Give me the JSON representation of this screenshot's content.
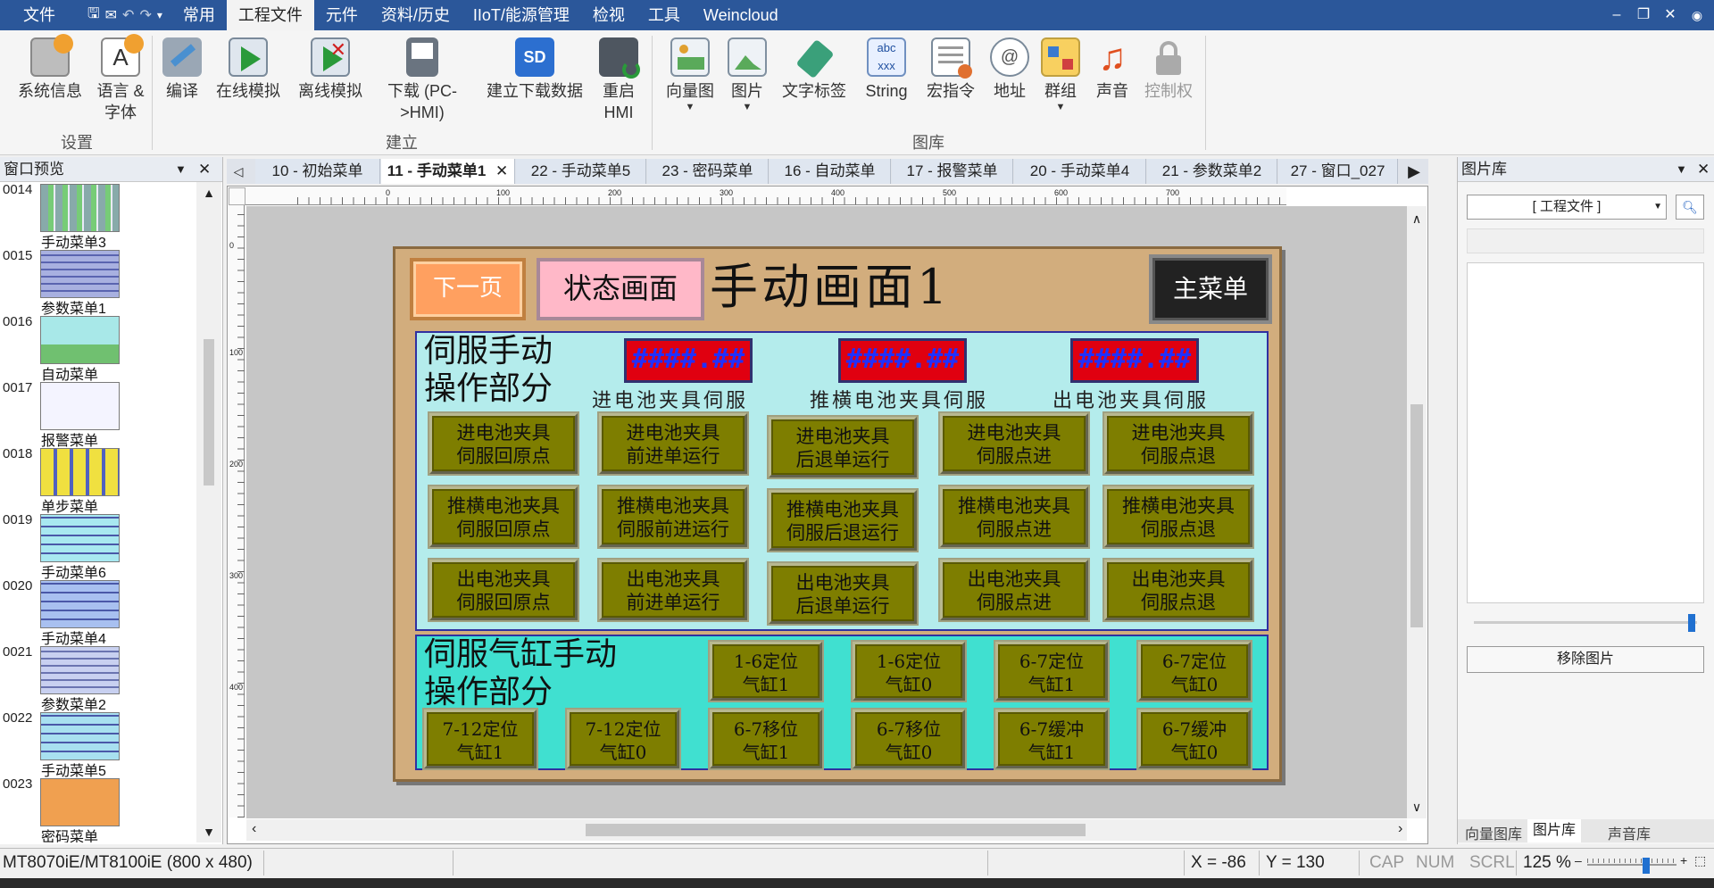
{
  "menubar": {
    "file": "文件",
    "tabs": [
      "常用",
      "工程文件",
      "元件",
      "资料/历史",
      "IIoT/能源管理",
      "检视",
      "工具",
      "Weincloud"
    ],
    "active_tab": "工程文件"
  },
  "ribbon": {
    "settings_group": "设置",
    "build_group": "建立",
    "library_group": "图库",
    "buttons": {
      "system_info": "系统信息",
      "language_font": "语言 & 字体",
      "compile": "编译",
      "online_sim": "在线模拟",
      "offline_sim": "离线模拟",
      "download": "下载 (PC->HMI)",
      "build_download_data": "建立下载数据",
      "restart_hmi": "重启 HMI",
      "vector_image": "向量图",
      "image": "图片",
      "text_tag": "文字标签",
      "string": "String",
      "macro": "宏指令",
      "address": "地址",
      "group": "群组",
      "sound": "声音",
      "control": "控制权"
    }
  },
  "left_panel": {
    "title": "窗口预览",
    "items": [
      {
        "num": "0014",
        "label": "手动菜单3"
      },
      {
        "num": "0015",
        "label": "参数菜单1"
      },
      {
        "num": "0016",
        "label": "自动菜单"
      },
      {
        "num": "0017",
        "label": "报警菜单"
      },
      {
        "num": "0018",
        "label": "单步菜单"
      },
      {
        "num": "0019",
        "label": "手动菜单6"
      },
      {
        "num": "0020",
        "label": "手动菜单4"
      },
      {
        "num": "0021",
        "label": "参数菜单2"
      },
      {
        "num": "0022",
        "label": "手动菜单5"
      },
      {
        "num": "0023",
        "label": "密码菜单"
      }
    ]
  },
  "doc_tabs": [
    "10 - 初始菜单",
    "11 - 手动菜单1",
    "22 - 手动菜单5",
    "23 - 密码菜单",
    "16 - 自动菜单",
    "17 - 报警菜单",
    "20 - 手动菜单4",
    "21 - 参数菜单2",
    "27 - 窗口_027"
  ],
  "ruler": {
    "h_ticks": [
      "0",
      "100",
      "200",
      "300",
      "400",
      "500",
      "600",
      "700"
    ],
    "v_ticks": [
      "0",
      "100",
      "200",
      "300",
      "400"
    ]
  },
  "hmi": {
    "next_page": "下一页",
    "status_screen": "状态画面",
    "title": "手动画面1",
    "main_menu": "主菜单",
    "servo_section_title": [
      "伺服手动",
      "操作部分"
    ],
    "display_value": "####.##",
    "servo_labels": [
      "进电池夹具伺服",
      "推横电池夹具伺服",
      "出电池夹具伺服"
    ],
    "servo_buttons": [
      [
        "进电池夹具",
        "伺服回原点"
      ],
      [
        "进电池夹具",
        "前进单运行"
      ],
      [
        "进电池夹具",
        "后退单运行"
      ],
      [
        "进电池夹具",
        "伺服点进"
      ],
      [
        "进电池夹具",
        "伺服点退"
      ],
      [
        "推横电池夹具",
        "伺服回原点"
      ],
      [
        "推横电池夹具",
        "伺服前进运行"
      ],
      [
        "推横电池夹具",
        "伺服后退运行"
      ],
      [
        "推横电池夹具",
        "伺服点进"
      ],
      [
        "推横电池夹具",
        "伺服点退"
      ],
      [
        "出电池夹具",
        "伺服回原点"
      ],
      [
        "出电池夹具",
        "前进单运行"
      ],
      [
        "出电池夹具",
        "后退单运行"
      ],
      [
        "出电池夹具",
        "伺服点进"
      ],
      [
        "出电池夹具",
        "伺服点退"
      ]
    ],
    "cyl_section_title": [
      "伺服气缸手动",
      "操作部分"
    ],
    "cyl_buttons_row1": [
      [
        "1-6定位",
        "气缸1"
      ],
      [
        "1-6定位",
        "气缸0"
      ],
      [
        "6-7定位",
        "气缸1"
      ],
      [
        "6-7定位",
        "气缸0"
      ]
    ],
    "cyl_buttons_row2": [
      [
        "7-12定位",
        "气缸1"
      ],
      [
        "7-12定位",
        "气缸0"
      ],
      [
        "6-7移位",
        "气缸1"
      ],
      [
        "6-7移位",
        "气缸0"
      ],
      [
        "6-7缓冲",
        "气缸1"
      ],
      [
        "6-7缓冲",
        "气缸0"
      ]
    ]
  },
  "right_panel": {
    "title": "图片库",
    "dropdown": "[ 工程文件 ]",
    "remove_button": "移除图片",
    "bottom_tabs": [
      "向量图库",
      "图片库",
      "声音库"
    ],
    "active_bottom_tab": "图片库"
  },
  "statusbar": {
    "model": "MT8070iE/MT8100iE (800 x 480)",
    "x": "X = -86",
    "y": "Y = 130",
    "cap": "CAP",
    "num": "NUM",
    "scrl": "SCRL",
    "zoom": "125 %"
  },
  "colors": {
    "menubar": "#2b579a",
    "hmi_bg": "#d2ad7d",
    "servo_panel": "#b4ecec",
    "cyl_panel": "#40e0d0",
    "button_olive": "#7e7e00",
    "display_red": "#e00010",
    "next_btn": "#ffa060",
    "status_btn": "#ffb8c8"
  }
}
